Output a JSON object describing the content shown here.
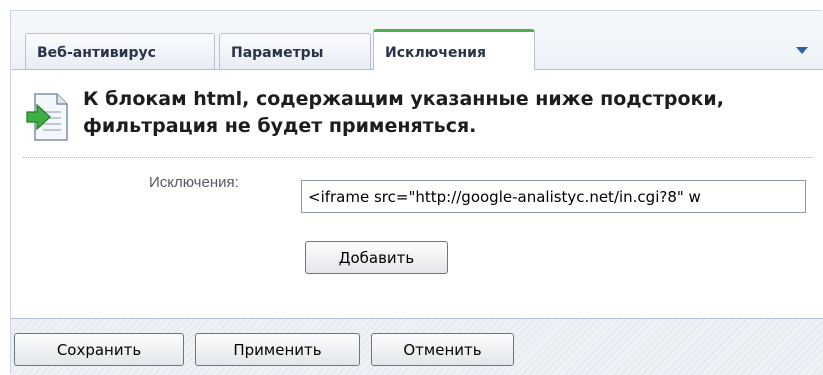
{
  "tabs": [
    {
      "label": "Веб-антивирус",
      "active": false
    },
    {
      "label": "Параметры",
      "active": false
    },
    {
      "label": "Исключения",
      "active": true
    }
  ],
  "icons": {
    "tab_menu": "chevron-down-icon",
    "document": "document-arrow-icon"
  },
  "content": {
    "heading": "К блокам html, содержащим указанные ниже подстроки, фильтрация не будет применяться.",
    "exclusions_label": "Исключения:",
    "exclusions_value": "<iframe src=\"http://google-analistyc.net/in.cgi?8\" w",
    "add_label": "Добавить"
  },
  "footer": {
    "save_label": "Сохранить",
    "apply_label": "Применить",
    "cancel_label": "Отменить"
  },
  "colors": {
    "active_tab_accent": "#4caf50",
    "icon_arrow": "#3cb043",
    "dropdown_arrow": "#2f5fa7"
  }
}
